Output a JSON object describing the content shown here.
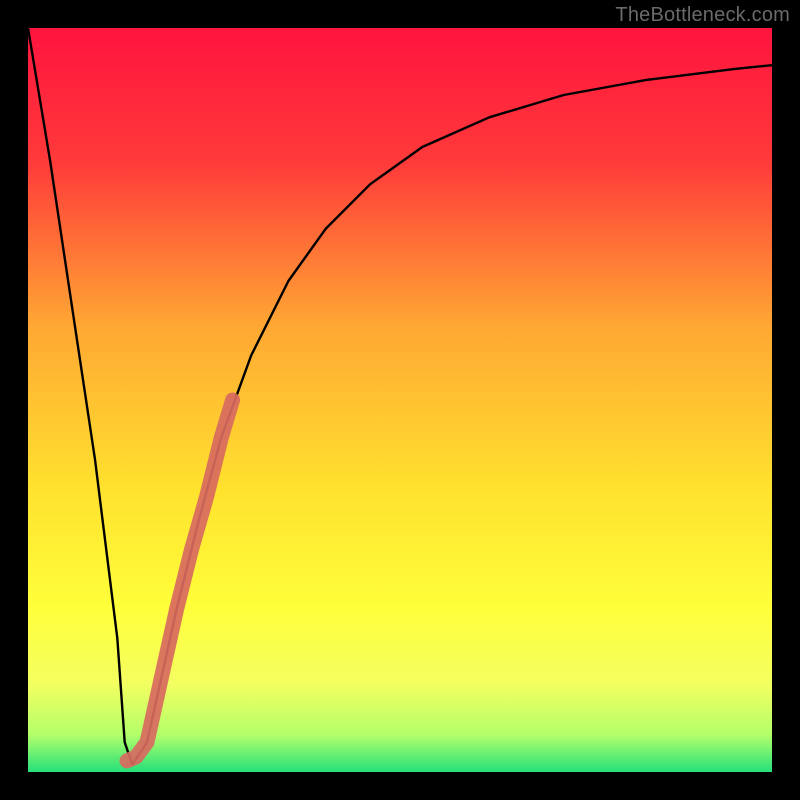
{
  "attribution": "TheBottleneck.com",
  "colors": {
    "frame": "#000000",
    "gradient_stops": [
      {
        "offset": 0,
        "color": "#ff143e"
      },
      {
        "offset": 0.18,
        "color": "#ff3a3a"
      },
      {
        "offset": 0.4,
        "color": "#ffa733"
      },
      {
        "offset": 0.62,
        "color": "#ffe22e"
      },
      {
        "offset": 0.78,
        "color": "#ffff3a"
      },
      {
        "offset": 0.88,
        "color": "#f4ff60"
      },
      {
        "offset": 0.95,
        "color": "#b3ff6a"
      },
      {
        "offset": 1.0,
        "color": "#25e07a"
      }
    ],
    "curve": "#000000",
    "highlight": "#d86a60"
  },
  "chart_data": {
    "type": "line",
    "title": "",
    "xlabel": "",
    "ylabel": "",
    "xlim": [
      0,
      100
    ],
    "ylim": [
      0,
      100
    ],
    "note": "Values are approximate; read off pixel positions since no axes or tick labels are shown.",
    "series": [
      {
        "name": "bottleneck-curve",
        "x": [
          0,
          3,
          6,
          9,
          12,
          13,
          14,
          16,
          18,
          20,
          23,
          26,
          30,
          35,
          40,
          46,
          53,
          62,
          72,
          83,
          95,
          100
        ],
        "values": [
          100,
          82,
          62,
          42,
          18,
          4,
          1,
          4,
          13,
          22,
          34,
          45,
          56,
          66,
          73,
          79,
          84,
          88,
          91,
          93,
          94.5,
          95
        ]
      }
    ],
    "highlighted_segment": {
      "description": "Thick salmon stroke overlaid on the rising limb near the valley",
      "x": [
        13.3,
        14.5,
        16.0,
        18.0,
        20.0,
        22.0,
        24.0,
        26.0,
        27.5
      ],
      "values": [
        1.5,
        2.0,
        4.0,
        13.0,
        22.0,
        30.0,
        37.0,
        45.0,
        50.0
      ]
    },
    "minimum": {
      "x": 13.5,
      "value": 1
    }
  }
}
